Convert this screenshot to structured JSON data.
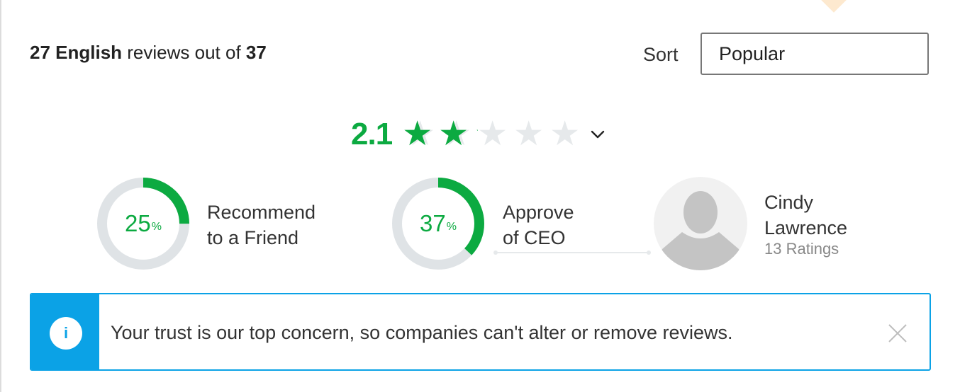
{
  "header": {
    "english_count": "27 English",
    "reviews_out_of": " reviews out of ",
    "total_count": "37"
  },
  "sort": {
    "label": "Sort",
    "selected": "Popular"
  },
  "rating": {
    "value": "2.1",
    "stars_filled": 2.1,
    "stars_total": 5,
    "star_glyph": "★",
    "expand_icon": "chevron-down-icon"
  },
  "metrics": {
    "recommend": {
      "percent": 25,
      "percent_number": "25",
      "percent_sign": "%",
      "line1": "Recommend",
      "line2": "to a Friend"
    },
    "approve_ceo": {
      "percent": 37,
      "percent_number": "37",
      "percent_sign": "%",
      "line1": "Approve",
      "line2": "of CEO"
    }
  },
  "ceo": {
    "first_name": "Cindy",
    "last_name": "Lawrence",
    "ratings": "13 Ratings",
    "avatar_icon": "avatar-placeholder-icon"
  },
  "notice": {
    "icon_glyph": "i",
    "text": "Your trust is our top concern, so companies can't alter or remove reviews.",
    "close_icon": "close-icon"
  },
  "colors": {
    "green": "#0caa41",
    "blue": "#0ba2e6",
    "ring_gray": "#dfe3e6",
    "star_gray": "#e6e9eb"
  }
}
